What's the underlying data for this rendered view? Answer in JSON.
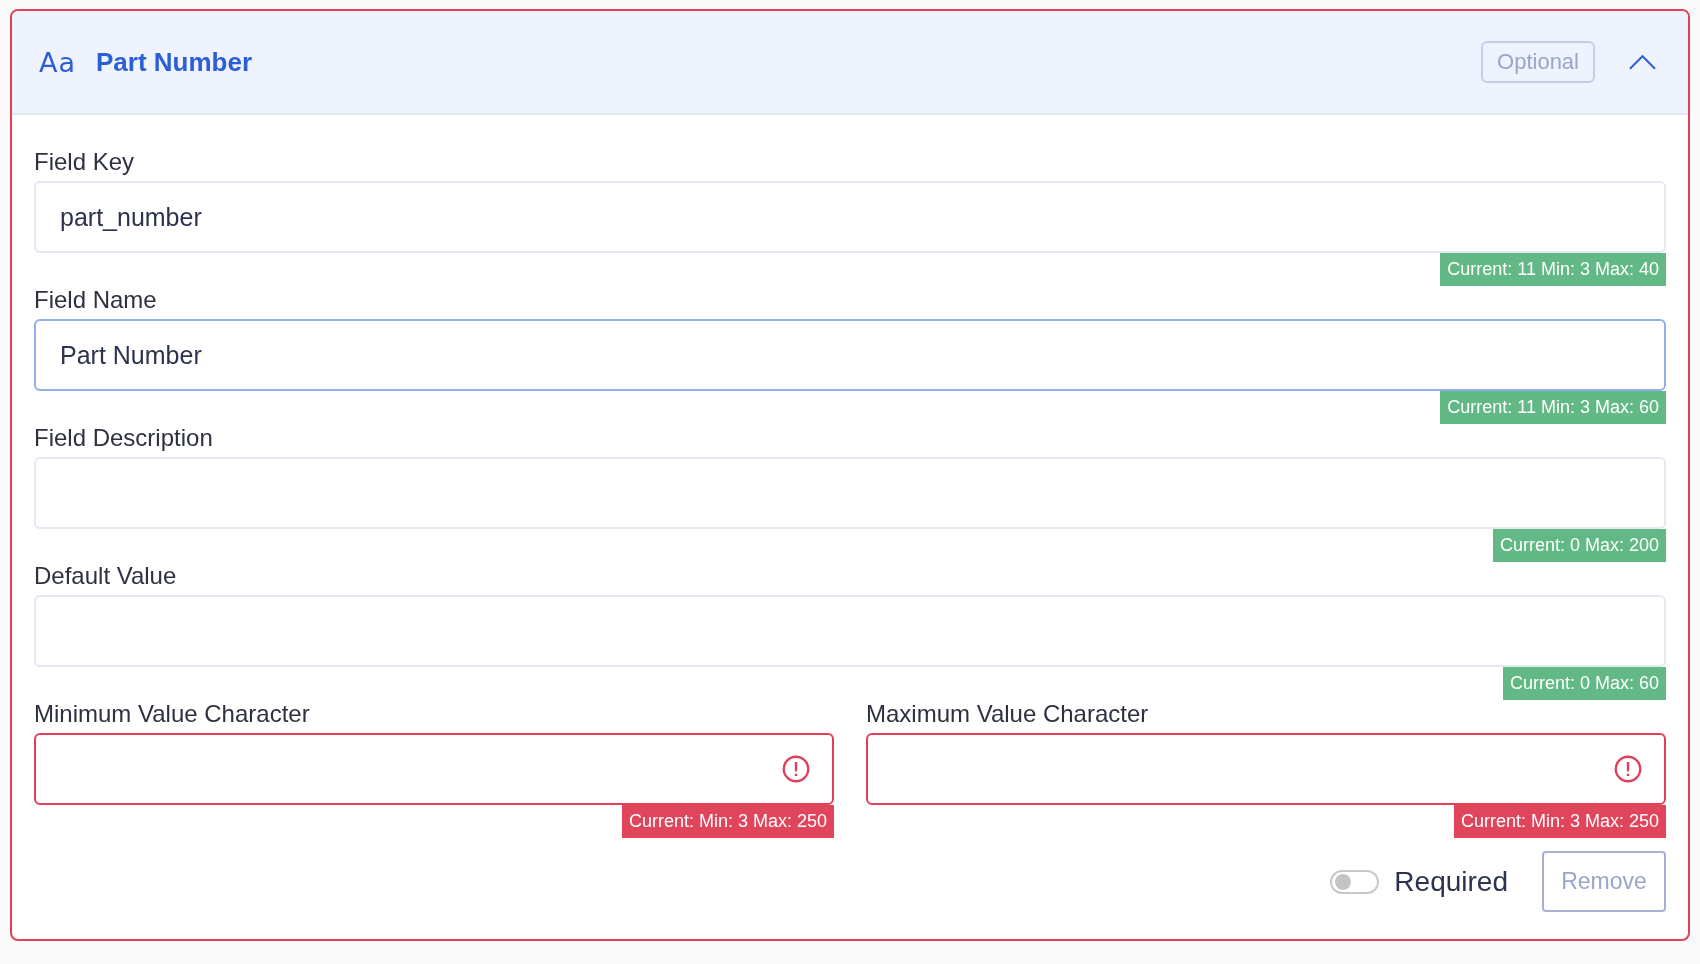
{
  "header": {
    "type_icon_text": "Aa",
    "title": "Part Number",
    "badge": "Optional",
    "expanded": true
  },
  "fields": [
    {
      "label": "Field Key",
      "value": "part_number",
      "focused": false,
      "error": false,
      "counter": "Current: 11 Min: 3 Max: 40"
    },
    {
      "label": "Field Name",
      "value": "Part Number",
      "focused": true,
      "error": false,
      "counter": "Current: 11 Min: 3 Max: 60"
    },
    {
      "label": "Field Description",
      "focused": false,
      "error": false,
      "counter": "Current: 0 Max: 200"
    },
    {
      "label": "Default Value",
      "focused": false,
      "error": false,
      "counter": "Current: 0 Max: 60"
    }
  ],
  "range_fields": [
    {
      "label": "Minimum Value Character",
      "focused": false,
      "error": true,
      "counter": "Current: Min: 3 Max: 250"
    },
    {
      "label": "Maximum Value Character",
      "focused": false,
      "error": true,
      "counter": "Current: Min: 3 Max: 250"
    }
  ],
  "footer": {
    "required_label": "Required",
    "required_on": false,
    "remove_button": "Remove"
  }
}
